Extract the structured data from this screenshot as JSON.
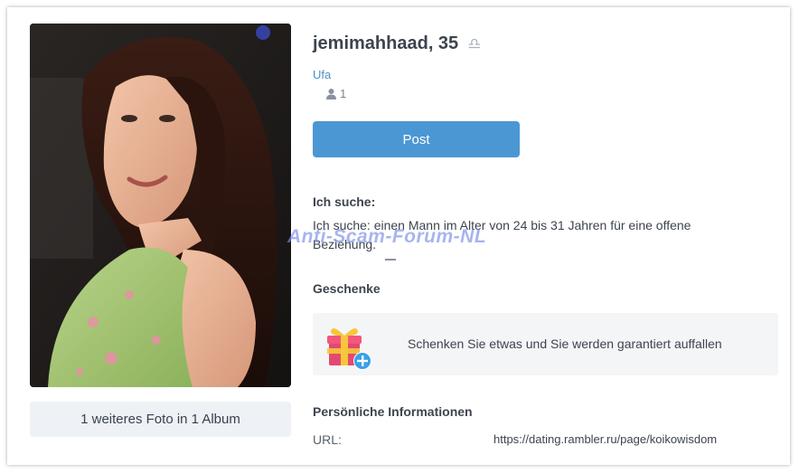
{
  "profile": {
    "name_age": "jemimahhaad, 35",
    "zodiac_icon": "libra-icon",
    "city": "Ufa",
    "photo_count": "1"
  },
  "actions": {
    "post_label": "Post"
  },
  "photos": {
    "more_label": "1 weiteres Foto in 1 Album"
  },
  "search": {
    "title": "Ich suche:",
    "text": "Ich suche: einen Mann im Alter von 24 bis 31 Jahren für eine offene Beziehung."
  },
  "watermark": "Anti-Scam-Forum-NL",
  "gifts": {
    "title": "Geschenke",
    "cta": "Schenken Sie etwas und Sie werden garantiert auffallen",
    "icon": "gift-plus-icon"
  },
  "personal_info": {
    "title": "Persönliche Informationen",
    "rows": [
      {
        "label": "URL:",
        "value": "https://dating.rambler.ru/page/koikowisdom"
      }
    ]
  },
  "colors": {
    "accent": "#4b97d4",
    "link": "#4a90c8",
    "watermark": "#788ce6"
  }
}
